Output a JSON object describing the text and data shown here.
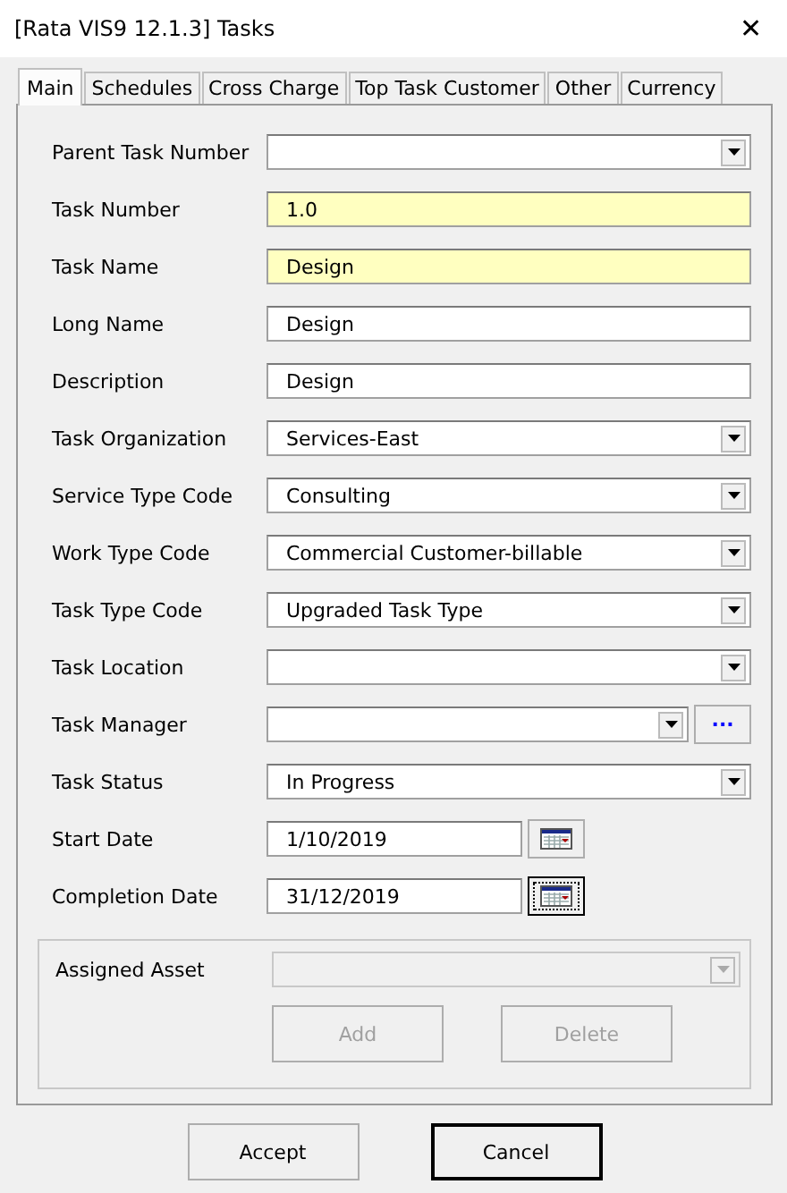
{
  "window": {
    "title": "[Rata VIS9 12.1.3] Tasks",
    "close": "✕"
  },
  "tabs": [
    {
      "label": "Main",
      "selected": true
    },
    {
      "label": "Schedules",
      "selected": false
    },
    {
      "label": "Cross Charge",
      "selected": false
    },
    {
      "label": "Top Task Customer",
      "selected": false
    },
    {
      "label": "Other",
      "selected": false
    },
    {
      "label": "Currency",
      "selected": false
    }
  ],
  "fields": [
    {
      "label": "Parent Task Number",
      "kind": "dropdown",
      "required": false
    },
    {
      "label": "Task Number",
      "kind": "text",
      "value": "1.0",
      "required": true
    },
    {
      "label": "Task Name",
      "kind": "text",
      "value": "Design",
      "required": true
    },
    {
      "label": "Long Name",
      "kind": "text",
      "value": "Design",
      "required": false
    },
    {
      "label": "Description",
      "kind": "text",
      "value": "Design",
      "required": false
    },
    {
      "label": "Task Organization",
      "kind": "dropdown",
      "value": "Services-East",
      "required": false
    },
    {
      "label": "Service Type Code",
      "kind": "dropdown",
      "value": "Consulting",
      "required": false
    },
    {
      "label": "Work Type Code",
      "kind": "dropdown",
      "value": "Commercial Customer-billable",
      "required": false
    },
    {
      "label": "Task Type Code",
      "kind": "dropdown",
      "value": "Upgraded Task Type",
      "required": false
    },
    {
      "label": "Task Location",
      "kind": "dropdown",
      "required": false
    },
    {
      "label": "Task Manager",
      "kind": "lookup",
      "button": "...",
      "required": false
    },
    {
      "label": "Task Status",
      "kind": "dropdown",
      "value": "In Progress",
      "required": false
    },
    {
      "label": "Start Date",
      "kind": "date",
      "value": "1/10/2019",
      "focused": false
    },
    {
      "label": "Completion Date",
      "kind": "date",
      "value": "31/12/2019",
      "focused": true
    }
  ],
  "asset": {
    "label": "Assigned Asset",
    "disabled": true,
    "buttons": [
      {
        "label": "Add",
        "disabled": true
      },
      {
        "label": "Delete",
        "disabled": true
      }
    ]
  },
  "buttons": [
    {
      "label": "Accept",
      "default": false
    },
    {
      "label": "Cancel",
      "default": true
    }
  ]
}
